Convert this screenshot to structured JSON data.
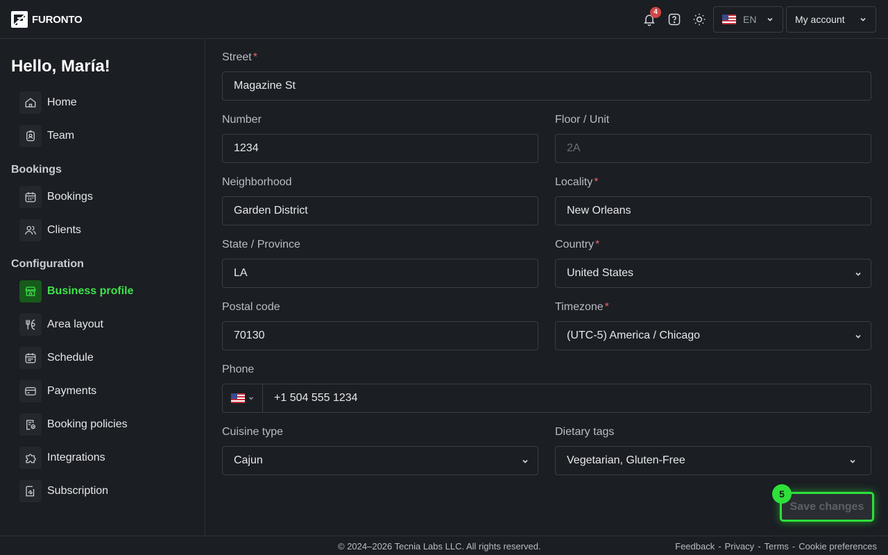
{
  "app": {
    "name": "FURONTO"
  },
  "header": {
    "notifications_count": "4",
    "language_code": "EN",
    "account_label": "My account"
  },
  "sidebar": {
    "greeting": "Hello, María!",
    "top_items": [
      {
        "label": "Home",
        "icon": "home-icon"
      },
      {
        "label": "Team",
        "icon": "badge-icon"
      }
    ],
    "sections": [
      {
        "title": "Bookings",
        "items": [
          {
            "label": "Bookings",
            "icon": "calendar-icon"
          },
          {
            "label": "Clients",
            "icon": "users-icon"
          }
        ]
      },
      {
        "title": "Configuration",
        "items": [
          {
            "label": "Business profile",
            "icon": "storefront-icon",
            "active": true
          },
          {
            "label": "Area layout",
            "icon": "cutlery-icon"
          },
          {
            "label": "Schedule",
            "icon": "schedule-icon"
          },
          {
            "label": "Payments",
            "icon": "card-icon"
          },
          {
            "label": "Booking policies",
            "icon": "policy-icon"
          },
          {
            "label": "Integrations",
            "icon": "puzzle-icon"
          },
          {
            "label": "Subscription",
            "icon": "subscription-icon"
          }
        ]
      }
    ]
  },
  "form": {
    "street": {
      "label": "Street",
      "required": "*",
      "value": "Magazine St"
    },
    "number": {
      "label": "Number",
      "value": "1234"
    },
    "floor_unit": {
      "label": "Floor / Unit",
      "placeholder": "2A"
    },
    "neighborhood": {
      "label": "Neighborhood",
      "value": "Garden District"
    },
    "locality": {
      "label": "Locality",
      "required": "*",
      "value": "New Orleans"
    },
    "state": {
      "label": "State / Province",
      "value": "LA"
    },
    "country": {
      "label": "Country",
      "required": "*",
      "value": "United States"
    },
    "postal_code": {
      "label": "Postal code",
      "value": "70130"
    },
    "timezone": {
      "label": "Timezone",
      "required": "*",
      "value": "(UTC-5) America / Chicago"
    },
    "phone": {
      "label": "Phone",
      "value": "+1 504 555 1234"
    },
    "cuisine": {
      "label": "Cuisine type",
      "value": "Cajun"
    },
    "dietary": {
      "label": "Dietary tags",
      "value": "Vegetarian, Gluten-Free"
    }
  },
  "actions": {
    "save_label": "Save changes",
    "step_badge": "5"
  },
  "footer": {
    "copyright": "© 2024–2026 Tecnia Labs LLC. All rights reserved.",
    "links": [
      "Feedback",
      "Privacy",
      "Terms",
      "Cookie preferences"
    ],
    "separator": "-"
  },
  "colors": {
    "accent": "#2ee03a",
    "required": "#e06666",
    "badge": "#d14545",
    "background": "#1b1e23"
  }
}
